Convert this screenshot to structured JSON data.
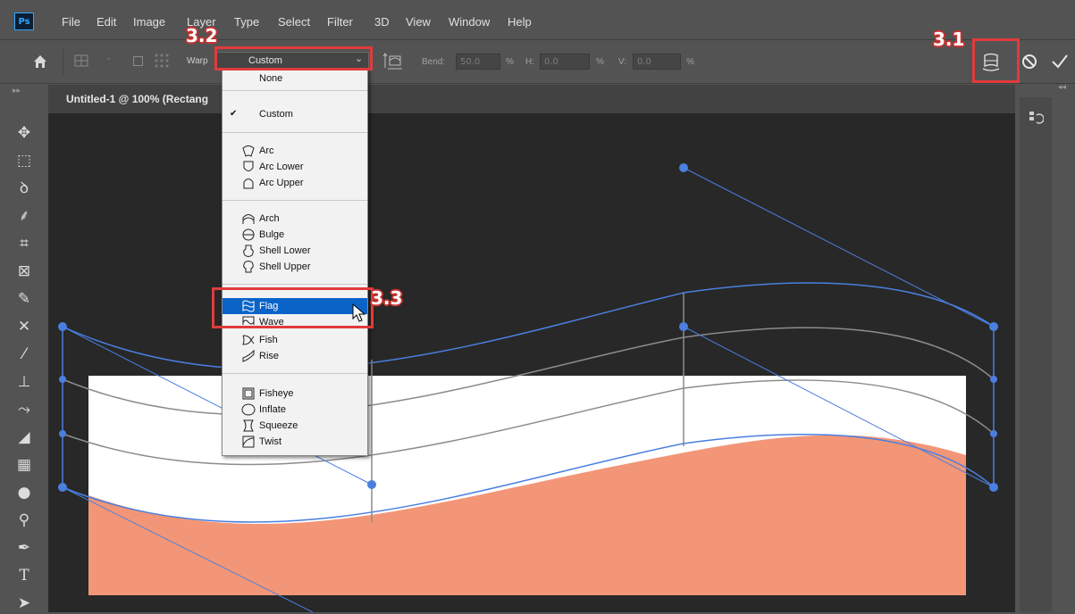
{
  "app": {
    "logo": "Ps"
  },
  "menubar": {
    "items": [
      "File",
      "Edit",
      "Image",
      "Layer",
      "Type",
      "Select",
      "Filter",
      "3D",
      "View",
      "Window",
      "Help"
    ]
  },
  "options": {
    "warp_label": "Warp",
    "warp_style_value": "Custom",
    "bend_label": "Bend:",
    "bend_value": "50.0",
    "h_label": "H:",
    "h_value": "0.0",
    "v_label": "V:",
    "v_value": "0.0",
    "percent": "%"
  },
  "document": {
    "tab_title": "Untitled-1 @ 100% (Rectang"
  },
  "callouts": {
    "step1": "3.1",
    "step2": "3.2",
    "step3": "3.3"
  },
  "dropdown": {
    "items": [
      {
        "label": "None",
        "icon": "none",
        "checked": false,
        "selected": false
      },
      {
        "label": "Custom",
        "icon": "none",
        "checked": true,
        "selected": false
      },
      {
        "label": "Arc",
        "icon": "arc-icon",
        "checked": false,
        "selected": false
      },
      {
        "label": "Arc Lower",
        "icon": "arc-lower-icon",
        "checked": false,
        "selected": false
      },
      {
        "label": "Arc Upper",
        "icon": "arc-upper-icon",
        "checked": false,
        "selected": false
      },
      {
        "label": "Arch",
        "icon": "arch-icon",
        "checked": false,
        "selected": false
      },
      {
        "label": "Bulge",
        "icon": "bulge-icon",
        "checked": false,
        "selected": false
      },
      {
        "label": "Shell Lower",
        "icon": "shell-lower-icon",
        "checked": false,
        "selected": false
      },
      {
        "label": "Shell Upper",
        "icon": "shell-upper-icon",
        "checked": false,
        "selected": false
      },
      {
        "label": "Flag",
        "icon": "flag-icon",
        "checked": false,
        "selected": true
      },
      {
        "label": "Wave",
        "icon": "wave-icon",
        "checked": false,
        "selected": false
      },
      {
        "label": "Fish",
        "icon": "fish-icon",
        "checked": false,
        "selected": false
      },
      {
        "label": "Rise",
        "icon": "rise-icon",
        "checked": false,
        "selected": false
      },
      {
        "label": "Fisheye",
        "icon": "fisheye-icon",
        "checked": false,
        "selected": false
      },
      {
        "label": "Inflate",
        "icon": "inflate-icon",
        "checked": false,
        "selected": false
      },
      {
        "label": "Squeeze",
        "icon": "squeeze-icon",
        "checked": false,
        "selected": false
      },
      {
        "label": "Twist",
        "icon": "twist-icon",
        "checked": false,
        "selected": false
      }
    ]
  },
  "colors": {
    "ui_bg": "#535353",
    "canvas_bg": "#282828",
    "shape_fill": "#f29677",
    "warp_handle": "#4a7fe0",
    "highlight": "#0a64c8",
    "callout_red": "#e13b3b"
  }
}
